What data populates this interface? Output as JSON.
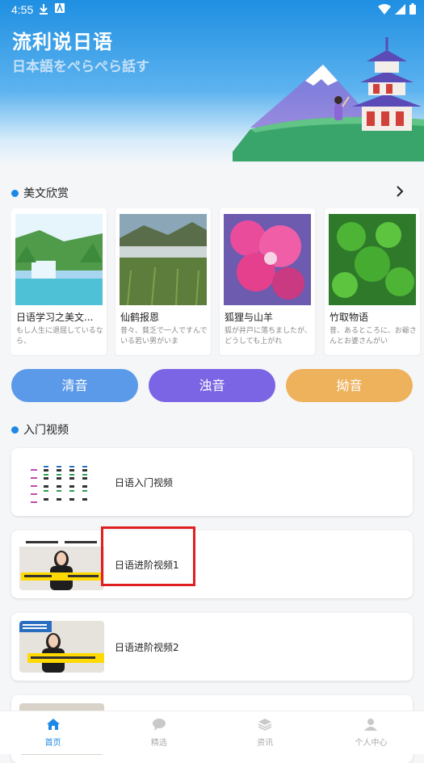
{
  "status_bar": {
    "time": "4:55"
  },
  "header": {
    "title": "流利说日语",
    "subtitle": "日本語をぺらぺら話す"
  },
  "section_essays": {
    "label": "美文欣赏"
  },
  "essays": [
    {
      "title": "日语学习之美文...",
      "desc": "もし人生に退屈しているなら、"
    },
    {
      "title": "仙鹤报恩",
      "desc": "昔々、貧乏で一人ですんでいる若い男がいま"
    },
    {
      "title": "狐狸与山羊",
      "desc": "狐が井戸に落ちましたが、どうしても上がれ"
    },
    {
      "title": "竹取物语",
      "desc": "昔、あるところに、お爺さんとお婆さんがい"
    }
  ],
  "buttons": {
    "seion": "清音",
    "dakuon": "浊音",
    "youon": "拗音"
  },
  "section_videos": {
    "label": "入门视频"
  },
  "videos": [
    {
      "title": "日语入门视频"
    },
    {
      "title": "日语进阶视频1"
    },
    {
      "title": "日语进阶视频2"
    }
  ],
  "tabs": [
    {
      "label": "首页",
      "icon": "home-icon"
    },
    {
      "label": "精选",
      "icon": "chat-icon"
    },
    {
      "label": "资讯",
      "icon": "layers-icon"
    },
    {
      "label": "个人中心",
      "icon": "person-icon"
    }
  ],
  "colors": {
    "primary": "#1e88e5",
    "seion": "#5b9ae8",
    "dakuon": "#7b65e4",
    "youon": "#eeb15c"
  }
}
